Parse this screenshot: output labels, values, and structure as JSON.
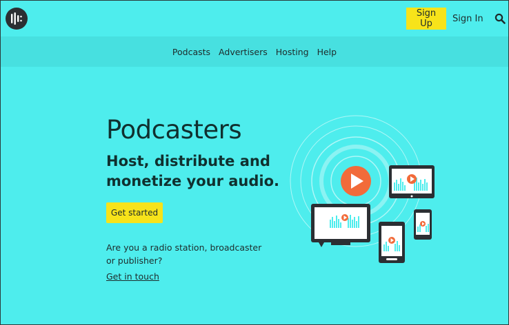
{
  "header": {
    "logo_icon": "audioboom-logo-icon",
    "signup_label": "Sign Up",
    "signin_label": "Sign In",
    "search_icon": "search-icon"
  },
  "subnav": {
    "items": [
      {
        "label": "Podcasts"
      },
      {
        "label": "Advertisers"
      },
      {
        "label": "Hosting"
      },
      {
        "label": "Help"
      }
    ]
  },
  "hero": {
    "title": "Podcasters",
    "subtitle": "Host, distribute and monetize your audio.",
    "cta_label": "Get started",
    "question": "Are you a radio station, broadcaster or publisher?",
    "contact_link": "Get in touch"
  },
  "colors": {
    "background": "#4eeded",
    "subnav_background": "#47e0e0",
    "accent_yellow": "#f7e31a",
    "play_orange": "#f26b3a",
    "dark": "#2b2f33"
  }
}
